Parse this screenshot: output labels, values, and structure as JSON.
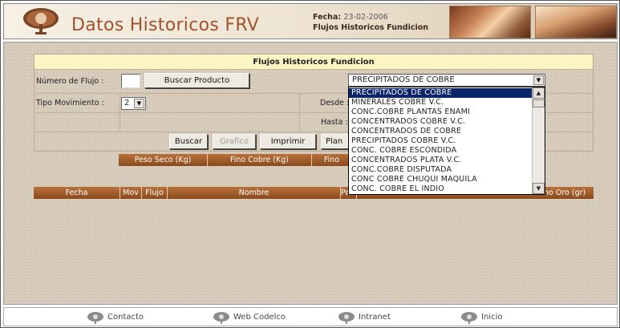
{
  "header": {
    "app_title": "Datos Historicos FRV",
    "fecha_label": "Fecha:",
    "fecha_value": "23-02-2006",
    "subtitle": "Flujos Historicos Fundicion"
  },
  "form": {
    "title": "Flujos Historicos Fundicion",
    "numero_flujo_label": "Número de Flujo :",
    "numero_flujo_value": "",
    "buscar_producto_label": "Buscar Producto",
    "tipo_movimiento_label": "Tipo Movimiento :",
    "tipo_movimiento_value": "2",
    "desde_label": "Desde :",
    "hasta_label": "Hasta :",
    "producto_selected": "PRECIPITADOS DE COBRE"
  },
  "buttons": {
    "buscar": "Buscar",
    "grafico": "Grafico",
    "imprimir": "Imprimir",
    "planilla": "Plan"
  },
  "summary_headers": [
    "Peso Seco (Kg)",
    "Fino Cobre (Kg)",
    "Fino"
  ],
  "table_headers": [
    "Fecha",
    "Mov",
    "Flujo",
    "Nombre",
    "Pe",
    "no Oro (gr)"
  ],
  "dropdown_options": [
    "PRECIPITADOS DE COBRE",
    "MINERALES COBRE V.C.",
    "CONC.COBRE PLANTAS ENAMI",
    "CONCENTRADOS COBRE V.C.",
    "CONCENTRADOS DE COBRE",
    "PRECIPITADOS COBRE V.C.",
    "CONC. COBRE ESCONDIDA",
    "CONCENTRADOS PLATA V.C.",
    "CONC.COBRE DISPUTADA",
    "CONC COBRE CHUQUI MAQUILA",
    "CONC. COBRE EL INDIO"
  ],
  "footer": {
    "contacto": "Contacto",
    "web_codelco": "Web Codelco",
    "intranet": "Intranet",
    "inicio": "Inicio"
  },
  "colors": {
    "title_color": "#a0522d",
    "bar_color": "#9a5a2a",
    "form_title_bg": "#fbf5c4",
    "selection": "#0a246a"
  }
}
